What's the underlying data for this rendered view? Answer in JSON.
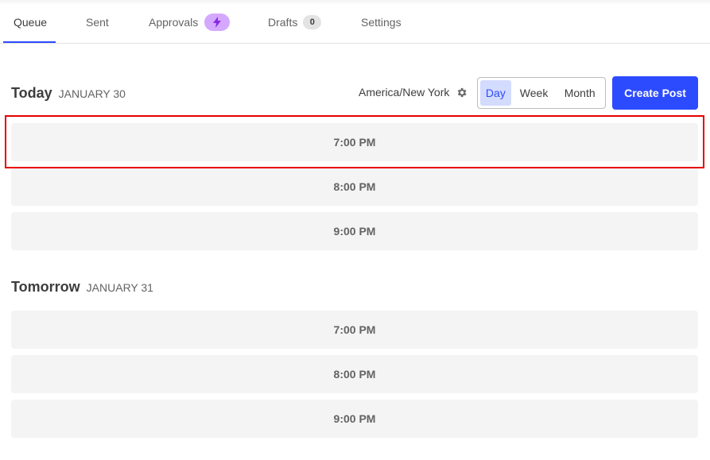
{
  "tabs": [
    {
      "label": "Queue",
      "active": true
    },
    {
      "label": "Sent",
      "active": false
    },
    {
      "label": "Approvals",
      "active": false,
      "badge_icon": "lightning-icon"
    },
    {
      "label": "Drafts",
      "active": false,
      "badge_count": "0"
    },
    {
      "label": "Settings",
      "active": false
    }
  ],
  "toolbar": {
    "timezone": "America/New York",
    "view_options": [
      {
        "label": "Day",
        "active": true
      },
      {
        "label": "Week",
        "active": false
      },
      {
        "label": "Month",
        "active": false
      }
    ],
    "create_label": "Create Post"
  },
  "days": [
    {
      "title": "Today",
      "date": "JANUARY 30",
      "slots": [
        "7:00 PM",
        "8:00 PM",
        "9:00 PM"
      ]
    },
    {
      "title": "Tomorrow",
      "date": "JANUARY 31",
      "slots": [
        "7:00 PM",
        "8:00 PM",
        "9:00 PM"
      ]
    }
  ],
  "colors": {
    "accent": "#2c4bff",
    "approvals_badge": "#d5a8ff",
    "highlight": "#e60000"
  }
}
